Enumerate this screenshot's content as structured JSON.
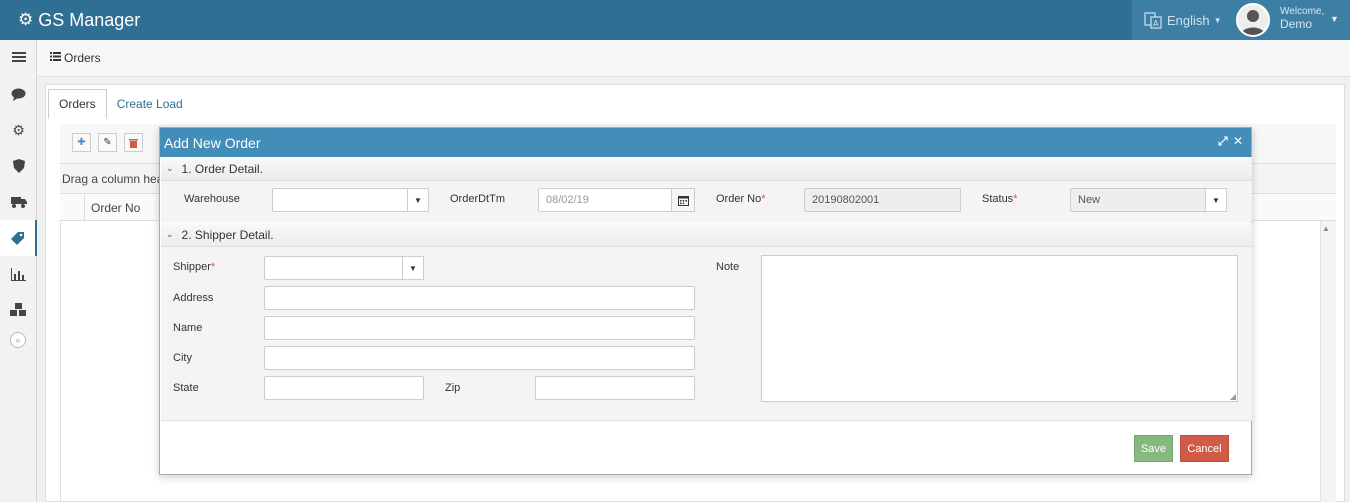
{
  "app": {
    "title": "GS Manager",
    "gear_icon": "gear-icon"
  },
  "header": {
    "language": "English",
    "welcome": "Welcome,",
    "user_name": "Demo"
  },
  "sidebar": {
    "items": [
      {
        "icon": "list-icon",
        "glyph": "☰"
      },
      {
        "icon": "comment-icon",
        "glyph": "💬"
      },
      {
        "icon": "cog-icon",
        "glyph": "⚙"
      },
      {
        "icon": "shield-icon",
        "glyph": "⛉"
      },
      {
        "icon": "truck-icon",
        "glyph": "⛟"
      },
      {
        "icon": "tag-icon",
        "glyph": "✎"
      },
      {
        "icon": "bar-chart-icon",
        "glyph": "▥"
      },
      {
        "icon": "cubes-icon",
        "glyph": "❖"
      }
    ],
    "collapse_glyph": "«"
  },
  "breadcrumb": {
    "label": "Orders"
  },
  "tabs": [
    {
      "label": "Orders"
    },
    {
      "label": "Create Load"
    }
  ],
  "grid": {
    "group_hint": "Drag a column hea",
    "columns": [
      "Order No"
    ]
  },
  "modal": {
    "title": "Add New Order",
    "sections": {
      "order_detail": "1. Order Detail.",
      "shipper_detail": "2. Shipper Detail."
    },
    "order": {
      "warehouse_label": "Warehouse",
      "warehouse_value": "",
      "orderdttm_label": "OrderDtTm",
      "orderdttm_value": "08/02/19",
      "orderno_label": "Order No",
      "orderno_value": "20190802001",
      "status_label": "Status",
      "status_value": "New"
    },
    "shipper": {
      "shipper_label": "Shipper",
      "address_label": "Address",
      "name_label": "Name",
      "city_label": "City",
      "state_label": "State",
      "zip_label": "Zip",
      "note_label": "Note"
    },
    "buttons": {
      "save": "Save",
      "cancel": "Cancel"
    },
    "required_mark": "*"
  },
  "colors": {
    "navbar": "#2f6f94",
    "modal_header": "#438eb9",
    "save": "#87b87f",
    "cancel": "#d15b47",
    "required": "#d9534f"
  }
}
